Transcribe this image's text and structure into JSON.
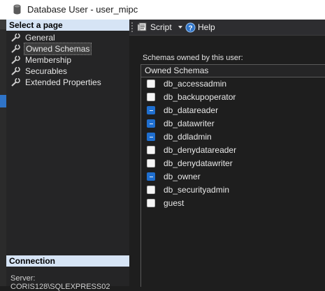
{
  "window": {
    "title": "Database User - user_mipc"
  },
  "left": {
    "select_header": "Select a page",
    "pages": [
      {
        "label": "General",
        "selected": false,
        "name": "general"
      },
      {
        "label": "Owned Schemas",
        "selected": true,
        "name": "owned-schemas"
      },
      {
        "label": "Membership",
        "selected": false,
        "name": "membership"
      },
      {
        "label": "Securables",
        "selected": false,
        "name": "securables"
      },
      {
        "label": "Extended Properties",
        "selected": false,
        "name": "extended-properties"
      }
    ],
    "connection_header": "Connection",
    "server_label": "Server:",
    "server_value": "CORIS128\\SQLEXPRESS02"
  },
  "toolbar": {
    "script_label": "Script",
    "help_label": "Help"
  },
  "main": {
    "schemas_label": "Schemas owned by this user:",
    "column_header": "Owned Schemas",
    "schemas": [
      {
        "name": "db_accessadmin",
        "checked": false
      },
      {
        "name": "db_backupoperator",
        "checked": false
      },
      {
        "name": "db_datareader",
        "checked": true
      },
      {
        "name": "db_datawriter",
        "checked": true
      },
      {
        "name": "db_ddladmin",
        "checked": true
      },
      {
        "name": "db_denydatareader",
        "checked": false
      },
      {
        "name": "db_denydatawriter",
        "checked": false
      },
      {
        "name": "db_owner",
        "checked": true
      },
      {
        "name": "db_securityadmin",
        "checked": false
      },
      {
        "name": "guest",
        "checked": false
      }
    ]
  },
  "colors": {
    "accent": "#1f6fd0",
    "section_header": "#d6e4f5",
    "background": "#1e1e1e"
  }
}
